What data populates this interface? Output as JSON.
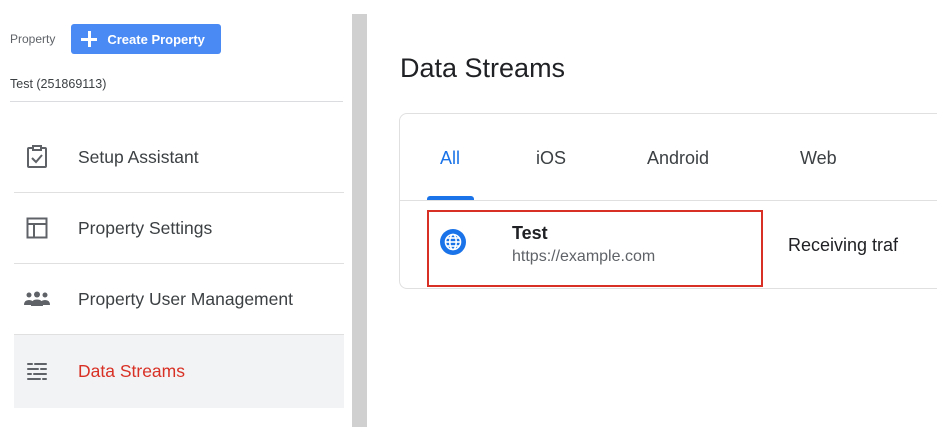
{
  "sidebar": {
    "property_label": "Property",
    "create_button_label": "Create Property",
    "property_name": "Test (251869113)",
    "items": [
      {
        "label": "Setup Assistant",
        "icon": "checklist-icon"
      },
      {
        "label": "Property Settings",
        "icon": "property-settings-icon"
      },
      {
        "label": "Property User Management",
        "icon": "users-icon"
      },
      {
        "label": "Data Streams",
        "icon": "data-streams-icon"
      }
    ],
    "active_item": "Data Streams"
  },
  "main": {
    "title": "Data Streams",
    "tabs": [
      {
        "label": "All"
      },
      {
        "label": "iOS"
      },
      {
        "label": "Android"
      },
      {
        "label": "Web"
      }
    ],
    "active_tab": "All",
    "streams": [
      {
        "name": "Test",
        "url": "https://example.com",
        "status": "Receiving traf",
        "icon": "globe-icon"
      }
    ]
  },
  "colors": {
    "accent": "#1a73e8",
    "button": "#4a8af4",
    "active_nav": "#d93025",
    "highlight": "#d93025"
  }
}
